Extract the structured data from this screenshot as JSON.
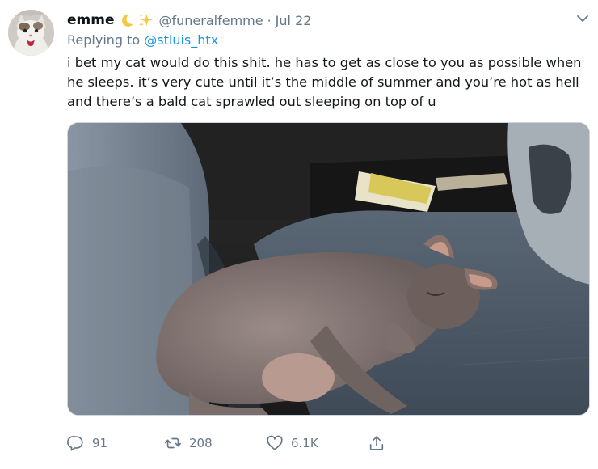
{
  "user": {
    "display_name": "emme",
    "emojis": [
      "crescent-moon",
      "sparkles"
    ],
    "handle": "@funeralfemme",
    "separator": "·",
    "date": "Jul 22"
  },
  "reply": {
    "prefix": "Replying to",
    "mention": "@stluis_htx"
  },
  "tweet": {
    "text": "i bet my cat would do this shit. he has to get as close to you as possible when he sleeps. it’s very cute until it’s the middle of summer and you’re hot as hell and there’s a bald cat sprawled out sleeping on top of u"
  },
  "actions": {
    "replies": "91",
    "retweets": "208",
    "likes": "6.1K"
  },
  "icons": {
    "reply": "reply-icon",
    "retweet": "retweet-icon",
    "like": "heart-icon",
    "share": "share-icon",
    "menu": "chevron-down-icon"
  },
  "colors": {
    "link": "#1b95e0",
    "secondary_text": "#657786",
    "primary_text": "#14171a"
  }
}
